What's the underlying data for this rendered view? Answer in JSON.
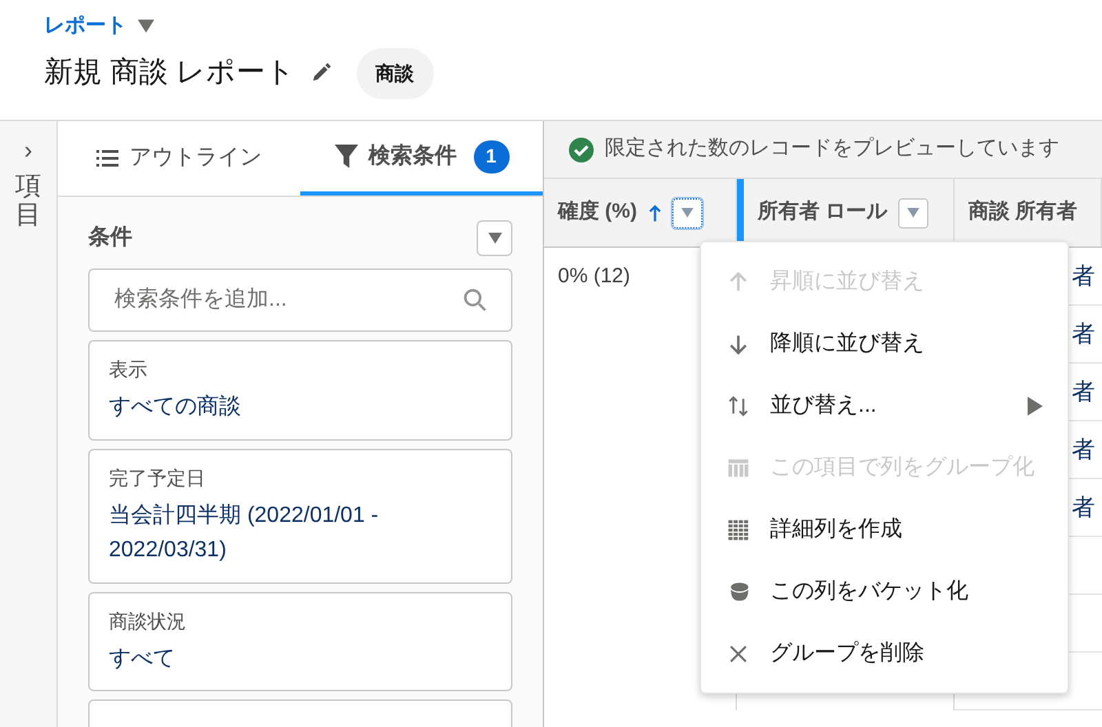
{
  "header": {
    "breadcrumb": "レポート",
    "title": "新規 商談 レポート",
    "badge": "商談"
  },
  "fields_strip": {
    "label": "項目",
    "expand_icon": "›"
  },
  "tabs": [
    {
      "label": "アウトライン",
      "kind": "outline",
      "selected": false
    },
    {
      "label": "検索条件",
      "kind": "filter",
      "selected": true,
      "count": "1"
    }
  ],
  "filters": {
    "title": "条件",
    "search": {
      "placeholder": "検索条件を追加..."
    },
    "cards": [
      {
        "label": "表示",
        "value": "すべての商談"
      },
      {
        "label": "完了予定日",
        "value": "当会計四半期 (2022/01/01 - 2022/03/31)"
      },
      {
        "label": "商談状況",
        "value": "すべて"
      }
    ],
    "partial_card_below": true
  },
  "preview_banner": "限定された数のレコードをプレビューしています",
  "table": {
    "columns": [
      {
        "label": "確度 (%)",
        "sorted_ascending": true,
        "menu_button": true,
        "menu_open": true
      },
      {
        "label": "所有者 ロール",
        "sorted_ascending": false,
        "menu_button": true,
        "menu_open": false
      },
      {
        "label": "商談 所有者",
        "sorted_ascending": false,
        "menu_button": false
      }
    ],
    "rows": [
      {
        "cells": [
          "0% (12)",
          "",
          "者"
        ]
      },
      {
        "cells": [
          "",
          "",
          "者"
        ]
      },
      {
        "cells": [
          "",
          "",
          "者"
        ]
      },
      {
        "cells": [
          "",
          "",
          "者"
        ]
      },
      {
        "cells": [
          "",
          "",
          "者"
        ]
      },
      {
        "cells": [
          "",
          "",
          ""
        ]
      },
      {
        "cells": [
          "",
          "",
          ""
        ]
      },
      {
        "cells": [
          "",
          "",
          ""
        ]
      }
    ]
  },
  "column_menu": [
    {
      "kind": "sort-up",
      "label": "昇順に並び替え",
      "disabled": true,
      "submenu": false
    },
    {
      "kind": "sort-down",
      "label": "降順に並び替え",
      "disabled": false,
      "submenu": false
    },
    {
      "kind": "sort-both",
      "label": "並び替え...",
      "disabled": false,
      "submenu": true
    },
    {
      "kind": "group",
      "label": "この項目で列をグループ化",
      "disabled": true,
      "submenu": false
    },
    {
      "kind": "detail",
      "label": "詳細列を作成",
      "disabled": false,
      "submenu": false
    },
    {
      "kind": "bucket",
      "label": "この列をバケット化",
      "disabled": false,
      "submenu": false
    },
    {
      "kind": "remove",
      "label": "グループを削除",
      "disabled": false,
      "submenu": false
    }
  ]
}
